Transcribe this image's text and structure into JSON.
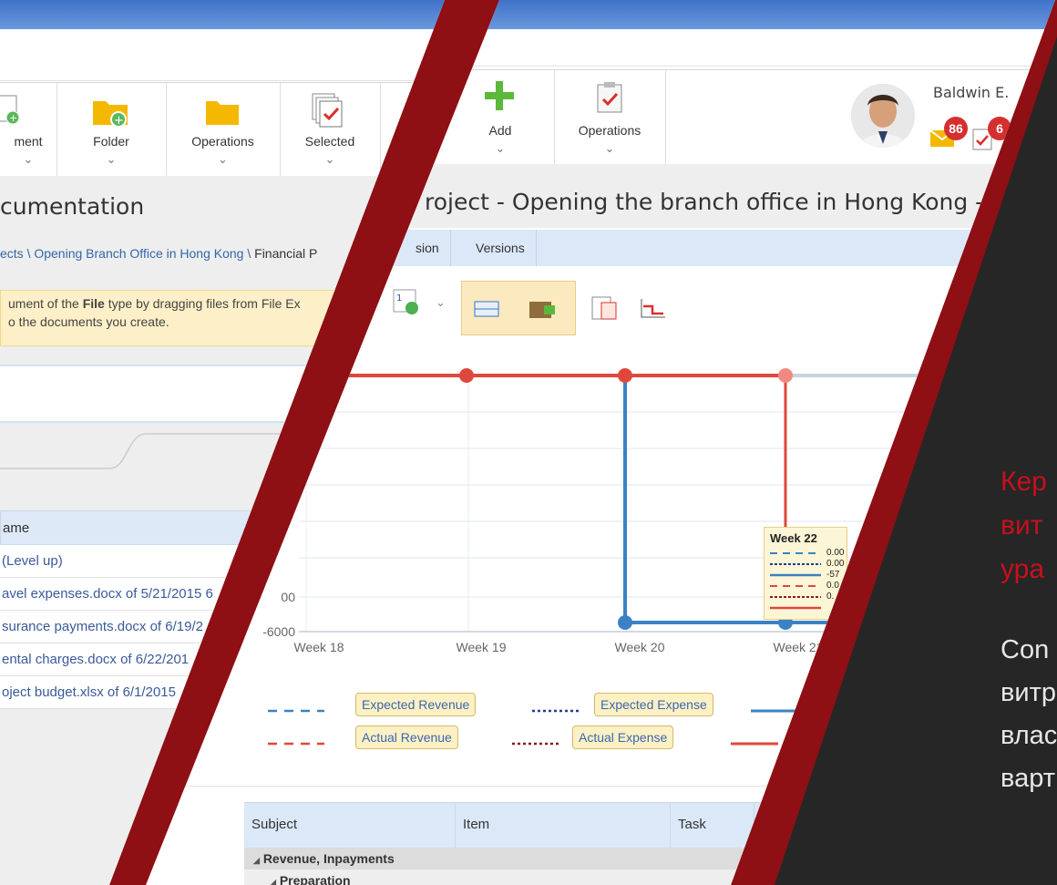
{
  "left_panel": {
    "toolbar": {
      "document_label": "ment",
      "folder_label": "Folder",
      "operations_label": "Operations",
      "selected_label": "Selected"
    },
    "page_title": "cumentation",
    "breadcrumb_links": "ects \\ Opening Branch Office in Hong Kong \\",
    "breadcrumb_current": " Financial P",
    "notice_line1_pre": "ument of the ",
    "notice_line1_bold": "File",
    "notice_line1_post": " type by dragging files from File Ex",
    "notice_line2": "o the documents you create.",
    "table_header": "ame",
    "rows": [
      "(Level up)",
      "avel expenses.docx of 5/21/2015 6",
      "surance payments.docx of 6/19/2",
      "ental charges.docx of 6/22/201",
      "oject budget.xlsx of 6/1/2015"
    ]
  },
  "right_panel": {
    "toolbar": {
      "add_label": "Add",
      "operations_label": "Operations"
    },
    "user": {
      "name": "Baldwin E.",
      "mail_count": "86",
      "task_count": "6"
    },
    "project_title": "roject - Opening the branch office in Hong Kong -",
    "tabs": [
      "sion",
      "Versions"
    ],
    "chart_data": {
      "type": "line",
      "x": [
        "Week 18",
        "Week 19",
        "Week 20",
        "Week 21"
      ],
      "y_tick_labels": [
        "00",
        "-6000"
      ],
      "tooltip": {
        "title": "Week 22",
        "values": [
          "0.00",
          "0.00",
          "-57",
          "0.0",
          "0."
        ]
      },
      "legend": [
        "Expected Revenue",
        "Expected Expense",
        "Actual Revenue",
        "Actual Expense"
      ],
      "colors": {
        "blue": "#3b82c4",
        "red": "#e0473c",
        "dark_red": "#8b1a1a",
        "navy": "#1f3f8f"
      }
    },
    "grid_headers": [
      "Subject",
      "Item",
      "Task"
    ],
    "grid_rows": [
      "Revenue, Inpayments",
      "Preparation"
    ]
  },
  "overlay": {
    "title_fragments": [
      "Кер",
      "вит",
      "ура"
    ],
    "text_fragments": [
      "Con",
      "витр",
      "влас",
      "варт"
    ]
  }
}
